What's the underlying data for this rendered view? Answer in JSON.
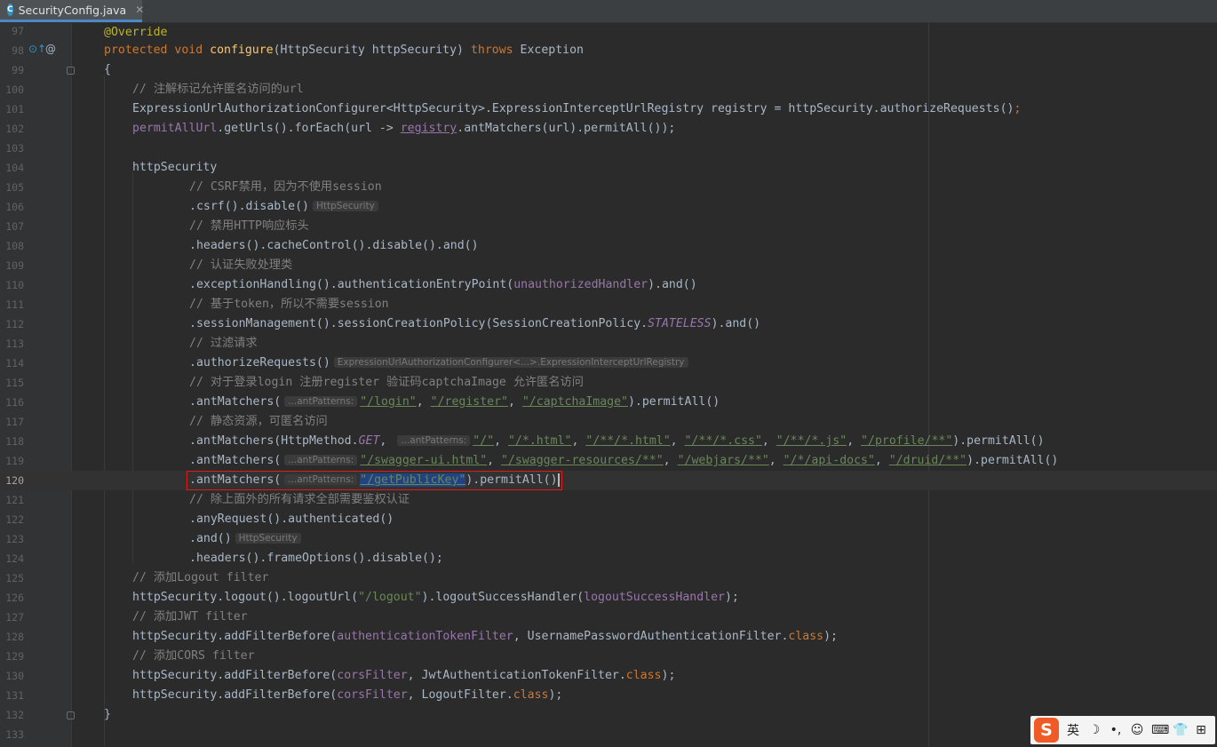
{
  "tab": {
    "icon_letter": "C",
    "title": "SecurityConfig.java",
    "close": "✕"
  },
  "gutter_icons": {
    "override_marker": "⊙↑",
    "annotation_marker": "@"
  },
  "lines": [
    {
      "n": "97"
    },
    {
      "n": "98"
    },
    {
      "n": "99"
    },
    {
      "n": "100"
    },
    {
      "n": "101"
    },
    {
      "n": "102"
    },
    {
      "n": "103"
    },
    {
      "n": "104"
    },
    {
      "n": "105"
    },
    {
      "n": "106"
    },
    {
      "n": "107"
    },
    {
      "n": "108"
    },
    {
      "n": "109"
    },
    {
      "n": "110"
    },
    {
      "n": "111"
    },
    {
      "n": "112"
    },
    {
      "n": "113"
    },
    {
      "n": "114"
    },
    {
      "n": "115"
    },
    {
      "n": "116"
    },
    {
      "n": "117"
    },
    {
      "n": "118"
    },
    {
      "n": "119"
    },
    {
      "n": "120"
    },
    {
      "n": "121"
    },
    {
      "n": "122"
    },
    {
      "n": "123"
    },
    {
      "n": "124"
    },
    {
      "n": "125"
    },
    {
      "n": "126"
    },
    {
      "n": "127"
    },
    {
      "n": "128"
    },
    {
      "n": "129"
    },
    {
      "n": "130"
    },
    {
      "n": "131"
    },
    {
      "n": "132"
    },
    {
      "n": "133"
    }
  ],
  "code": {
    "l97_annotation": "@Override",
    "l98_protected": "protected",
    "l98_void": "void",
    "l98_method": "configure",
    "l98_params": "(HttpSecurity httpSecurity)",
    "l98_throws": "throws",
    "l98_exception": "Exception",
    "l99_brace": "{",
    "l100_comment": "// 注解标记允许匿名访问的url",
    "l101_a": "ExpressionUrlAuthorizationConfigurer<HttpSecurity>.ExpressionInterceptUrlRegistry registry = httpSecurity.authorizeRequests()",
    "l101_semi": ";",
    "l102_field": "permitAllUrl",
    "l102_a": ".getUrls().forEach(url -> ",
    "l102_registry": "registry",
    "l102_b": ".antMatchers(url).permitAll());",
    "l104": "httpSecurity",
    "l105_comment": "// CSRF禁用，因为不使用session",
    "l106": ".csrf().disable()",
    "l106_hint": "HttpSecurity",
    "l107_comment": "// 禁用HTTP响应标头",
    "l108": ".headers().cacheControl().disable().and()",
    "l109_comment": "// 认证失败处理类",
    "l110_a": ".exceptionHandling().authenticationEntryPoint(",
    "l110_field": "unauthorizedHandler",
    "l110_b": ").and()",
    "l111_comment": "// 基于token，所以不需要session",
    "l112_a": ".sessionManagement().sessionCreationPolicy(SessionCreationPolicy.",
    "l112_const": "STATELESS",
    "l112_b": ").and()",
    "l113_comment": "// 过滤请求",
    "l114": ".authorizeRequests()",
    "l114_hint": "ExpressionUrlAuthorizationConfigurer<...>.ExpressionInterceptUrlRegistry",
    "l115_comment": "// 对于登录login 注册register 验证码captchaImage 允许匿名访问",
    "ant": ".antMatchers(",
    "ant_hint": "...antPatterns:",
    "l116_s1": "\"/login\"",
    "l116_s2": "\"/register\"",
    "l116_s3": "\"/captchaImage\"",
    "permit_all": ").permitAll()",
    "comma": ", ",
    "l117_comment": "// 静态资源，可匿名访问",
    "l118_a": ".antMatchers(HttpMethod.",
    "l118_const": "GET",
    "l118_s": [
      "\"/\"",
      "\"/*.html\"",
      "\"/**/*.html\"",
      "\"/**/*.css\"",
      "\"/**/*.js\"",
      "\"/profile/**\""
    ],
    "l119_s": [
      "\"/swagger-ui.html\"",
      "\"/swagger-resources/**\"",
      "\"/webjars/**\"",
      "\"/*/api-docs\"",
      "\"/druid/**\""
    ],
    "l120_s": "\"/getPublicKey\"",
    "l121_comment": "// 除上面外的所有请求全部需要鉴权认证",
    "l122": ".anyRequest().authenticated()",
    "l123": ".and()",
    "l123_hint": "HttpSecurity",
    "l124": ".headers().frameOptions().disable();",
    "l125_comment": "// 添加Logout filter",
    "l126_a": "httpSecurity.logout().logoutUrl(",
    "l126_s": "\"/logout\"",
    "l126_b": ").logoutSuccessHandler(",
    "l126_field": "logoutSuccessHandler",
    "l126_c": ");",
    "l127_comment": "// 添加JWT filter",
    "l128_a": "httpSecurity.addFilterBefore(",
    "l128_field": "authenticationTokenFilter",
    "l128_b": ", UsernamePasswordAuthenticationFilter.",
    "class_kw": "class",
    "end_paren": ");",
    "l129_comment": "// 添加CORS filter",
    "l130_a": "httpSecurity.addFilterBefore(",
    "l130_field": "corsFilter",
    "l130_b": ", JwtAuthenticationTokenFilter.",
    "l131_a": "httpSecurity.addFilterBefore(",
    "l131_field": "corsFilter",
    "l131_b": ", LogoutFilter.",
    "l132_brace": "}"
  },
  "ime": {
    "logo": "S",
    "items": [
      "英",
      "☽",
      "•,",
      "☺",
      "⌨",
      "👕",
      "⊞"
    ]
  },
  "colors": {
    "background": "#2b2b2b",
    "keyword": "#cc7832",
    "string": "#6a8759",
    "comment": "#808080",
    "highlight_box": "#e01b1b",
    "selection": "#214283"
  }
}
